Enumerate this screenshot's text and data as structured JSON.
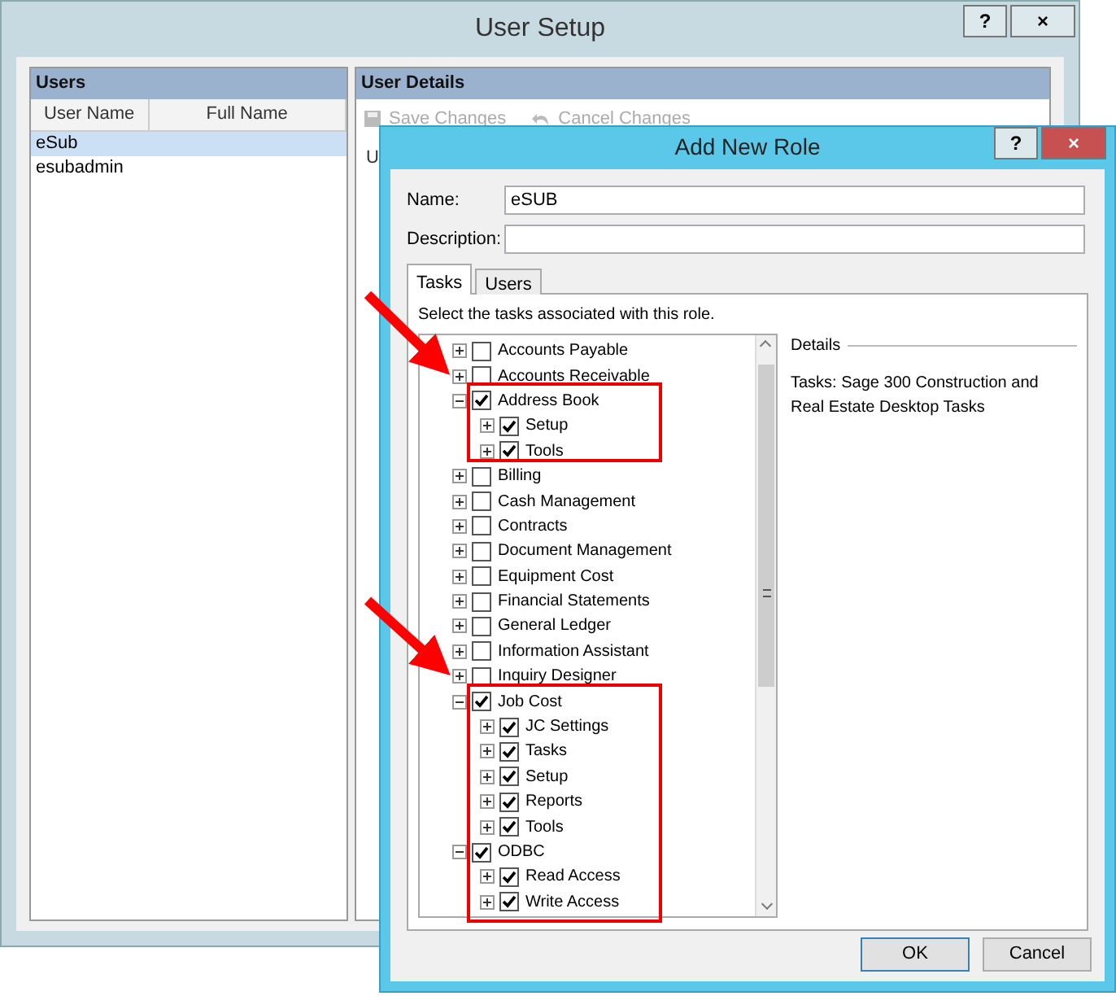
{
  "user_setup": {
    "title": "User Setup",
    "title_buttons": [
      "?",
      "×"
    ],
    "users_panel": {
      "title": "Users",
      "columns": [
        "User Name",
        "Full Name"
      ],
      "rows": [
        {
          "cells": [
            "eSub"
          ],
          "selected": true
        },
        {
          "cells": [
            "esubadmin"
          ],
          "selected": false
        }
      ]
    },
    "details_panel": {
      "title": "User Details",
      "toolbar": [
        {
          "label": "Save Changes",
          "disabled": true
        },
        {
          "label": "Cancel Changes",
          "disabled": true
        }
      ],
      "field_labels": [
        "U"
      ]
    }
  },
  "dialog": {
    "title": "Add New Role",
    "title_buttons": [
      "?",
      "×"
    ],
    "fields": [
      {
        "label": "Name:",
        "value": "eSUB"
      },
      {
        "label": "Description:"
      }
    ],
    "tabs": [
      {
        "label": "Tasks",
        "selected": true
      },
      {
        "label": "Users",
        "selected": false
      }
    ],
    "instruction": "Select the tasks associated with this role.",
    "tasks": [
      {
        "label": "Accounts Payable",
        "checked": false,
        "expanded": false
      },
      {
        "label": "Accounts Receivable",
        "checked": false,
        "expanded": false
      },
      {
        "label": "Address Book",
        "checked": true,
        "expanded": true,
        "children": [
          {
            "label": "Setup",
            "checked": true,
            "expanded": false
          },
          {
            "label": "Tools",
            "checked": true,
            "expanded": false
          }
        ]
      },
      {
        "label": "Billing",
        "checked": false,
        "expanded": false
      },
      {
        "label": "Cash Management",
        "checked": false,
        "expanded": false
      },
      {
        "label": "Contracts",
        "checked": false,
        "expanded": false
      },
      {
        "label": "Document Management",
        "checked": false,
        "expanded": false
      },
      {
        "label": "Equipment Cost",
        "checked": false,
        "expanded": false
      },
      {
        "label": "Financial Statements",
        "checked": false,
        "expanded": false
      },
      {
        "label": "General Ledger",
        "checked": false,
        "expanded": false
      },
      {
        "label": "Information Assistant",
        "checked": false,
        "expanded": false
      },
      {
        "label": "Inquiry Designer",
        "checked": false,
        "expanded": false
      },
      {
        "label": "Job Cost",
        "checked": true,
        "expanded": true,
        "children": [
          {
            "label": "JC Settings",
            "checked": true,
            "expanded": false
          },
          {
            "label": "Tasks",
            "checked": true,
            "expanded": false
          },
          {
            "label": "Setup",
            "checked": true,
            "expanded": false
          },
          {
            "label": "Reports",
            "checked": true,
            "expanded": false
          },
          {
            "label": "Tools",
            "checked": true,
            "expanded": false
          }
        ]
      },
      {
        "label": "ODBC",
        "checked": true,
        "expanded": true,
        "children": [
          {
            "label": "Read Access",
            "checked": true,
            "expanded": false
          },
          {
            "label": "Write Access",
            "checked": true,
            "expanded": false
          }
        ]
      }
    ],
    "details": {
      "title": "Details",
      "text": "Tasks: Sage 300 Construction and Real Estate Desktop Tasks"
    },
    "buttons": [
      {
        "label": "OK",
        "default": true
      },
      {
        "label": "Cancel",
        "default": false
      }
    ]
  }
}
